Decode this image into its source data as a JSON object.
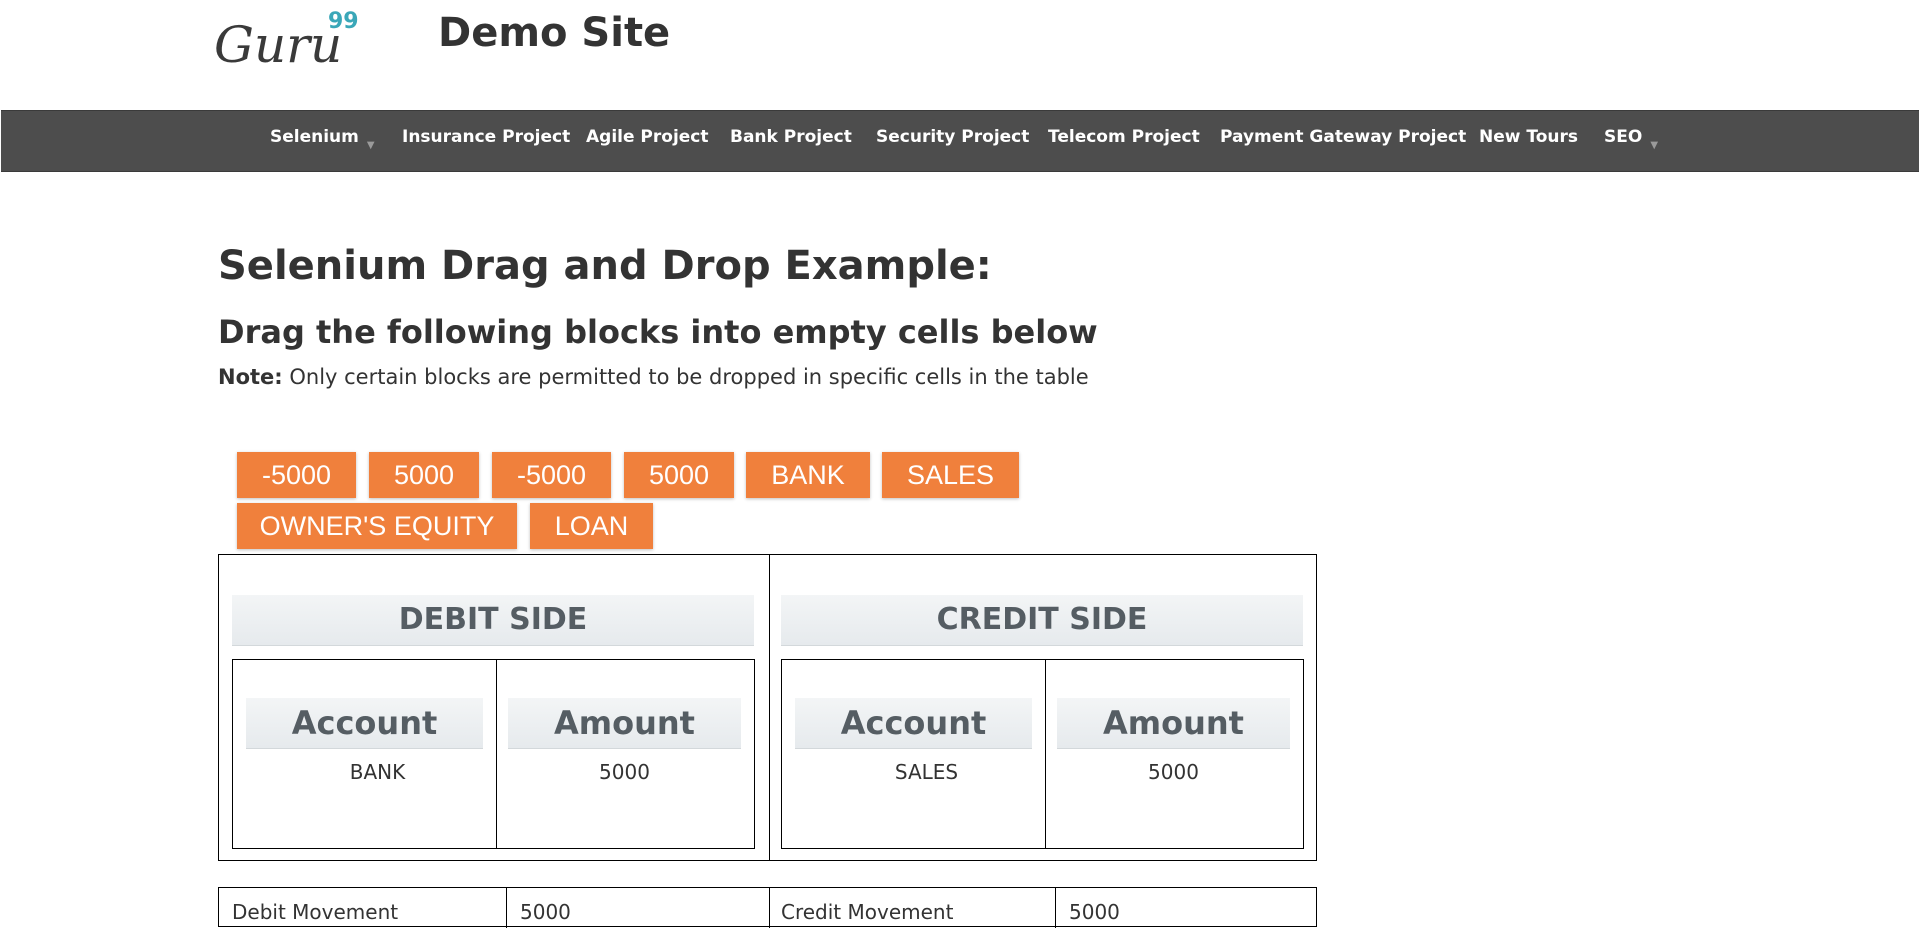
{
  "header": {
    "logo": {
      "text": "Guru",
      "superscript": "99"
    },
    "site_title": "Demo Site"
  },
  "nav": {
    "items": [
      {
        "label": "Selenium",
        "dropdown": true
      },
      {
        "label": "Insurance Project",
        "dropdown": false
      },
      {
        "label": "Agile Project",
        "dropdown": false
      },
      {
        "label": "Bank Project",
        "dropdown": false
      },
      {
        "label": "Security Project",
        "dropdown": false
      },
      {
        "label": "Telecom Project",
        "dropdown": false
      },
      {
        "label": "Payment Gateway Project",
        "dropdown": false
      },
      {
        "label": "New Tours",
        "dropdown": false
      },
      {
        "label": "SEO",
        "dropdown": true
      }
    ]
  },
  "main": {
    "heading": "Selenium Drag and Drop Example:",
    "subheading": "Drag the following blocks into empty cells below",
    "note_label": "Note:",
    "note_text": " Only certain blocks are permitted to be dropped in specific cells in the table"
  },
  "blocks": [
    "-5000",
    "5000",
    "-5000",
    "5000",
    "BANK",
    "SALES",
    "OWNER'S EQUITY",
    "LOAN"
  ],
  "table": {
    "debit": {
      "title": "DEBIT SIDE",
      "account_header": "Account",
      "amount_header": "Amount",
      "account_value": "BANK",
      "amount_value": "5000"
    },
    "credit": {
      "title": "CREDIT SIDE",
      "account_header": "Account",
      "amount_header": "Amount",
      "account_value": "SALES",
      "amount_value": "5000"
    }
  },
  "movement": {
    "debit_label": "Debit Movement",
    "debit_value": "5000",
    "credit_label": "Credit Movement",
    "credit_value": "5000"
  },
  "colors": {
    "nav_bg": "#4d4d4d",
    "block_bg": "#f0803c",
    "logo_accent": "#3aa7b8",
    "header_text": "#555d63"
  }
}
